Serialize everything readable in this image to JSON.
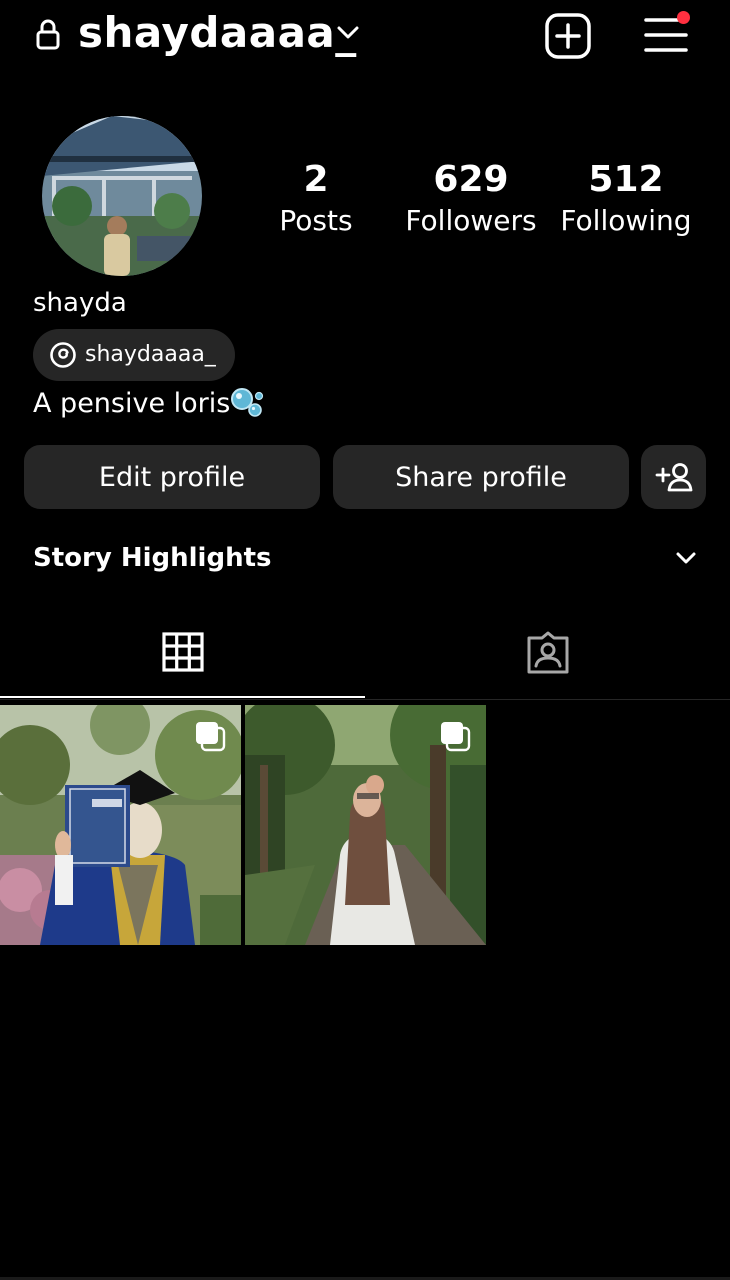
{
  "header": {
    "username": "shaydaaaa_",
    "has_notification": true
  },
  "profile": {
    "display_name": "shayda",
    "threads_handle": "shaydaaaa_",
    "bio": "A pensive loris",
    "bio_emoji": "bubbles-icon",
    "stats": [
      {
        "value": "2",
        "label": "Posts"
      },
      {
        "value": "629",
        "label": "Followers"
      },
      {
        "value": "512",
        "label": "Following"
      }
    ]
  },
  "actions": {
    "edit_label": "Edit profile",
    "share_label": "Share profile"
  },
  "highlights": {
    "label": "Story Highlights"
  },
  "tabs": [
    {
      "icon": "grid-icon",
      "active": true
    },
    {
      "icon": "tagged-icon",
      "active": false
    }
  ],
  "posts": [
    {
      "description": "graduation",
      "multi": true
    },
    {
      "description": "forest path",
      "multi": true
    }
  ],
  "colors": {
    "background": "#000000",
    "button": "#262626",
    "text": "#ffffff",
    "notification": "#ff3040"
  }
}
